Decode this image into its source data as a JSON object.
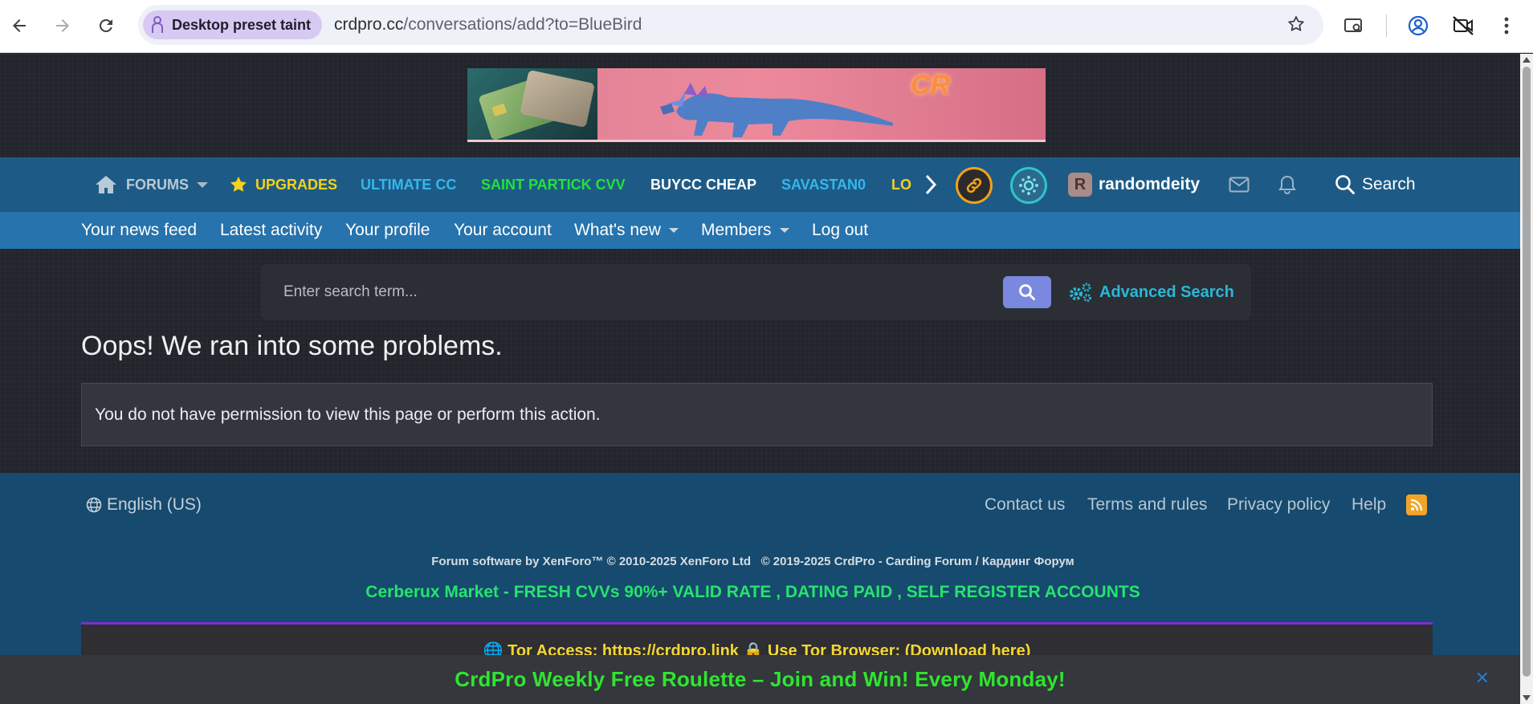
{
  "browser": {
    "taint_chip": "Desktop preset taint",
    "url_host": "crdpro.cc",
    "url_path": "/conversations/add?to=BlueBird"
  },
  "banner": {
    "logo_text": "CR"
  },
  "navbar": {
    "forums": "FORUMS",
    "upgrades": "UPGRADES",
    "ultimate_cc": "ULTIMATE CC",
    "saint_partick": "SAINT PARTICK CVV",
    "buycc": "BUYCC CHEAP",
    "savastan": "SAVASTAN0",
    "clipped": "LO",
    "username": "randomdeity",
    "avatar_letter": "R",
    "search": "Search",
    "colors": {
      "upgrades": "#f5d21b",
      "ultimate_cc": "#33b8ee",
      "saint_partick": "#22e23a",
      "buycc": "#ffffff",
      "savastan": "#33b8ee"
    }
  },
  "subnav": {
    "items": [
      "Your news feed",
      "Latest activity",
      "Your profile",
      "Your account",
      "What's new",
      "Members",
      "Log out"
    ]
  },
  "search": {
    "placeholder": "Enter search term...",
    "advanced": "Advanced Search"
  },
  "main": {
    "title": "Oops! We ran into some problems.",
    "error": "You do not have permission to view this page or perform this action."
  },
  "footer": {
    "language": "English (US)",
    "links": [
      "Contact us",
      "Terms and rules",
      "Privacy policy",
      "Help"
    ],
    "copyright": "Forum software by XenForo™ © 2010-2025 XenForo Ltd   © 2019-2025 CrdPro - Carding Forum / Кардинг Форум",
    "promo": "Cerberux Market - FRESH CVVs 90%+ VALID RATE , DATING PAID , SELF REGISTER ACCOUNTS",
    "tor": "🌐 Tor Access: https://crdpro.link 🔒 Use Tor Browser: (Download here)"
  },
  "notice": {
    "text": "CrdPro Weekly Free Roulette – Join and Win! Every Monday!",
    "close": "✕"
  }
}
